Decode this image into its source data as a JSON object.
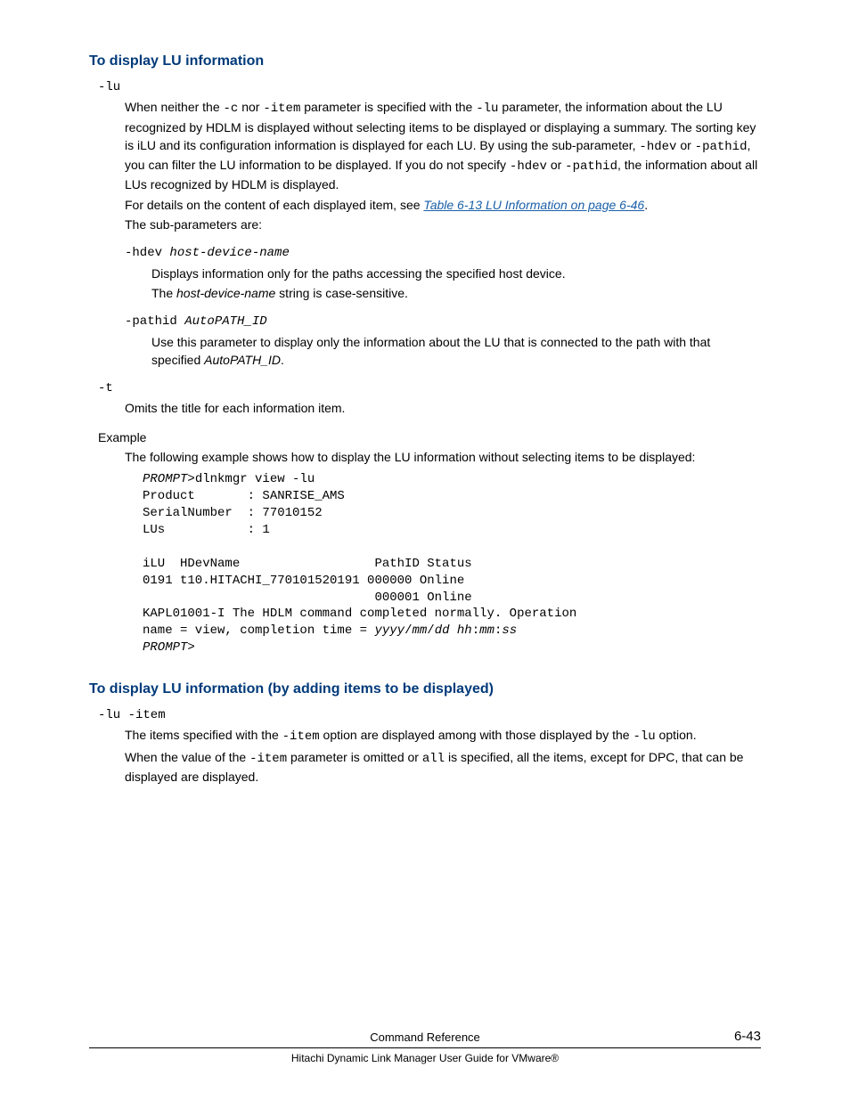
{
  "section1": {
    "heading": "To display LU information",
    "opt_lu": "-lu",
    "para1_a": "When neither the ",
    "para1_b": "-c",
    "para1_c": " nor ",
    "para1_d": "-item",
    "para1_e": " parameter is specified with the ",
    "para1_f": "-lu",
    "para1_g": " parameter, the information about the LU recognized by HDLM is displayed without selecting items to be displayed or displaying a summary. The sorting key is iLU and its configuration information is displayed for each LU. By using the sub-parameter, ",
    "para1_h": "-hdev",
    "para1_i": " or ",
    "para1_j": "-pathid",
    "para1_k": ", you can filter the LU information to be displayed. If you do not specify ",
    "para1_l": "-hdev",
    "para1_m": " or ",
    "para1_n": "-pathid",
    "para1_o": ", the information about all LUs recognized by HDLM is displayed.",
    "para2_a": "For details on the content of each displayed item, see ",
    "para2_link": "Table 6-13 LU Information on page 6-46",
    "para2_b": ".",
    "para3": "The sub-parameters are:",
    "hdev_label": "-hdev ",
    "hdev_arg": "host-device-name",
    "hdev_desc": "Displays information only for the paths accessing the specified host device.",
    "hdev_note_a": "The ",
    "hdev_note_b": "host-device-name",
    "hdev_note_c": " string is case-sensitive.",
    "pathid_label": "-pathid ",
    "pathid_arg": "AutoPATH_ID",
    "pathid_desc_a": "Use this parameter to display only the information about the LU that is connected to the path with that specified ",
    "pathid_desc_b": "AutoPATH_ID",
    "pathid_desc_c": ".",
    "opt_t": "-t",
    "t_desc": "Omits the title for each information item.",
    "example_label": "Example",
    "example_desc": "The following example shows how to display the LU information without selecting items to be displayed:",
    "example_output": "PROMPT>dlnkmgr view -lu\nProduct       : SANRISE_AMS\nSerialNumber  : 77010152\nLUs           : 1\n\niLU  HDevName                  PathID Status\n0191 t10.HITACHI_770101520191 000000 Online\n                               000001 Online\nKAPL01001-I The HDLM command completed normally. Operation \nname = view, completion time = yyyy/mm/dd hh:mm:ss\nPROMPT>"
  },
  "section2": {
    "heading": "To display LU information (by adding items to be displayed)",
    "opt": "-lu -item",
    "para1_a": "The items specified with the ",
    "para1_b": "-item",
    "para1_c": " option are displayed among with those displayed by the ",
    "para1_d": "-lu",
    "para1_e": " option.",
    "para2_a": "When the value of the ",
    "para2_b": "-item",
    "para2_c": " parameter is omitted or ",
    "para2_d": "all",
    "para2_e": " is specified, all the items, except for DPC, that can be displayed are displayed."
  },
  "footer": {
    "ref": "Command Reference",
    "page": "6-43",
    "guide": "Hitachi Dynamic Link Manager User Guide for VMware®"
  }
}
